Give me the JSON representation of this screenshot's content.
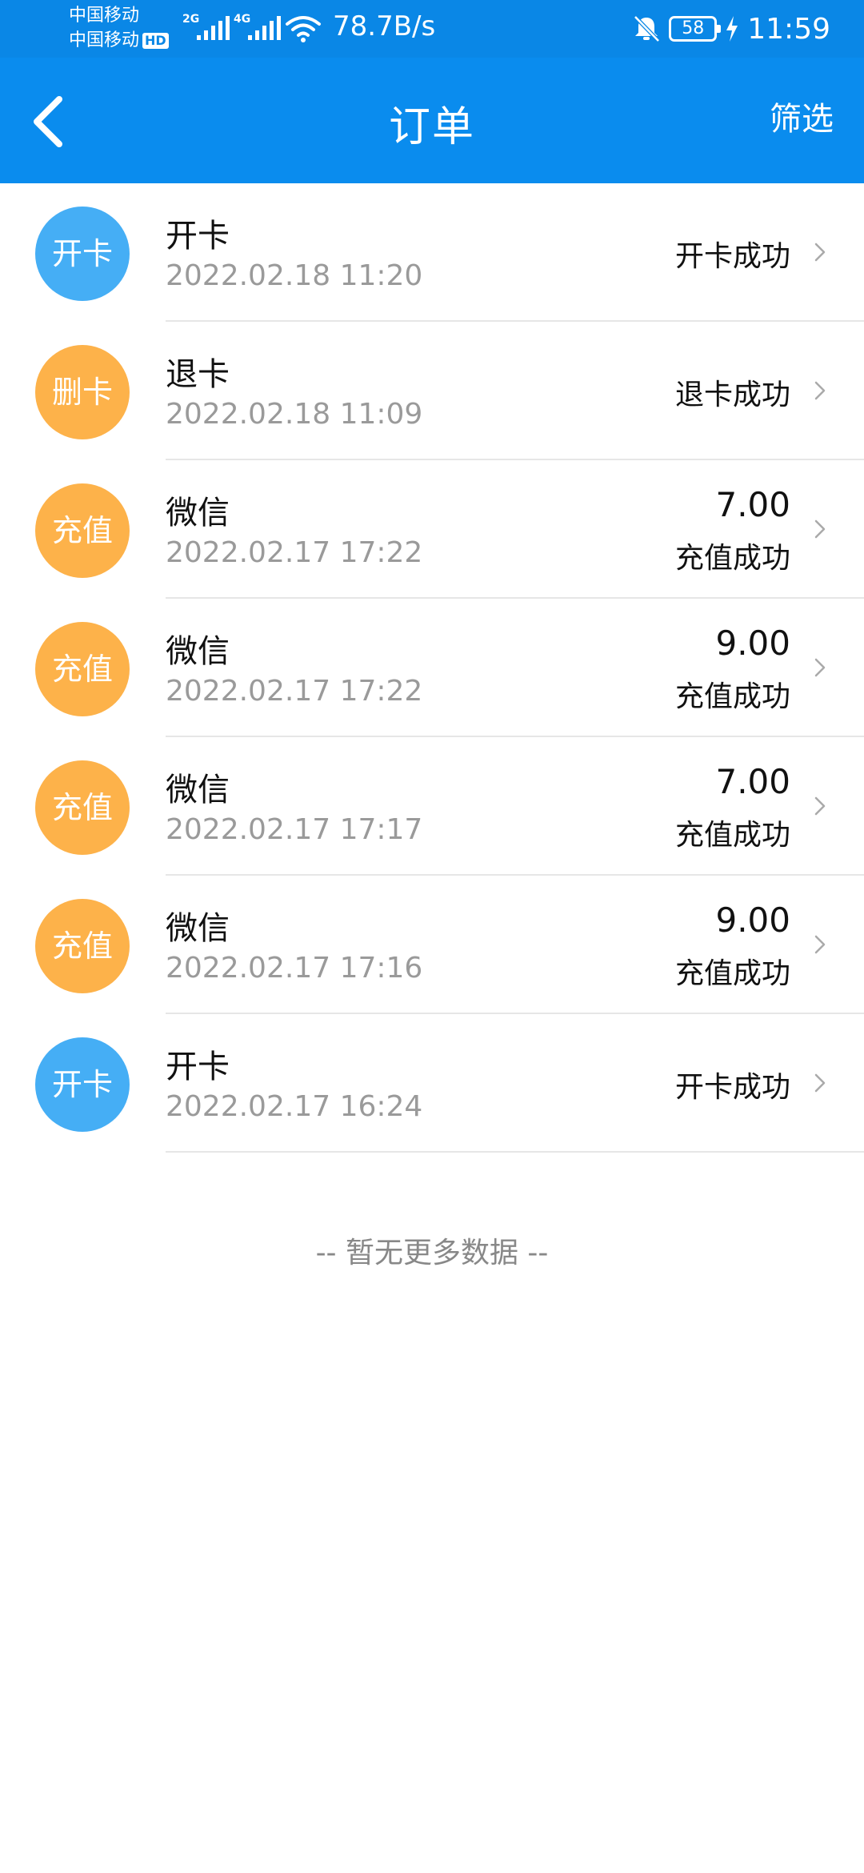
{
  "status_bar": {
    "carrier_1": "中国移动",
    "carrier_2": "中国移动",
    "hd_badge": "HD",
    "sim1_gen": "2G",
    "sim2_gen": "4G",
    "network_speed": "78.7B/s",
    "battery": "58",
    "time": "11:59"
  },
  "header": {
    "back_icon": "chevron-left-icon",
    "title": "订单",
    "filter_label": "筛选"
  },
  "orders": [
    {
      "badge": "开卡",
      "badge_color": "#45aef5",
      "title": "开卡",
      "time": "2022.02.18 11:20",
      "amount": "",
      "status": "开卡成功"
    },
    {
      "badge": "删卡",
      "badge_color": "#fdb24a",
      "title": "退卡",
      "time": "2022.02.18 11:09",
      "amount": "",
      "status": "退卡成功"
    },
    {
      "badge": "充值",
      "badge_color": "#fdb24a",
      "title": "微信",
      "time": "2022.02.17 17:22",
      "amount": "7.00",
      "status": "充值成功"
    },
    {
      "badge": "充值",
      "badge_color": "#fdb24a",
      "title": "微信",
      "time": "2022.02.17 17:22",
      "amount": "9.00",
      "status": "充值成功"
    },
    {
      "badge": "充值",
      "badge_color": "#fdb24a",
      "title": "微信",
      "time": "2022.02.17 17:17",
      "amount": "7.00",
      "status": "充值成功"
    },
    {
      "badge": "充值",
      "badge_color": "#fdb24a",
      "title": "微信",
      "time": "2022.02.17 17:16",
      "amount": "9.00",
      "status": "充值成功"
    },
    {
      "badge": "开卡",
      "badge_color": "#45aef5",
      "title": "开卡",
      "time": "2022.02.17 16:24",
      "amount": "",
      "status": "开卡成功"
    }
  ],
  "footer": {
    "no_more_text": "-- 暂无更多数据 --"
  },
  "colors": {
    "primary": "#0a8cee",
    "badge_blue": "#45aef5",
    "badge_orange": "#fdb24a",
    "secondary_text": "#9a9a9a"
  }
}
